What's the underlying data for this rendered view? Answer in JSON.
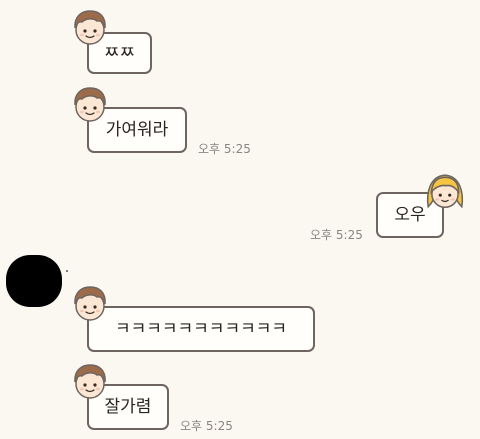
{
  "messages": [
    {
      "side": "left",
      "sender": "boy",
      "text": "ㅉㅉ",
      "time": ""
    },
    {
      "side": "left",
      "sender": "boy",
      "text": "가여워라",
      "time": "오후 5:25"
    },
    {
      "side": "right",
      "sender": "girl",
      "text": "오우",
      "time": "오후 5:25"
    },
    {
      "side": "left",
      "sender": "boy",
      "text": "ㅋㅋㅋㅋㅋㅋㅋㅋㅋㅋㅋ",
      "time": ""
    },
    {
      "side": "left",
      "sender": "boy",
      "text": "잘가렴",
      "time": "오후 5:25"
    }
  ],
  "colors": {
    "background": "#fbf8f2",
    "bubble_border": "#6e6560",
    "boy_hair": "#9b6b4a",
    "girl_hair": "#f5c542"
  },
  "icons": [
    "boy-avatar-icon",
    "girl-avatar-icon",
    "profile-photo-redacted"
  ]
}
